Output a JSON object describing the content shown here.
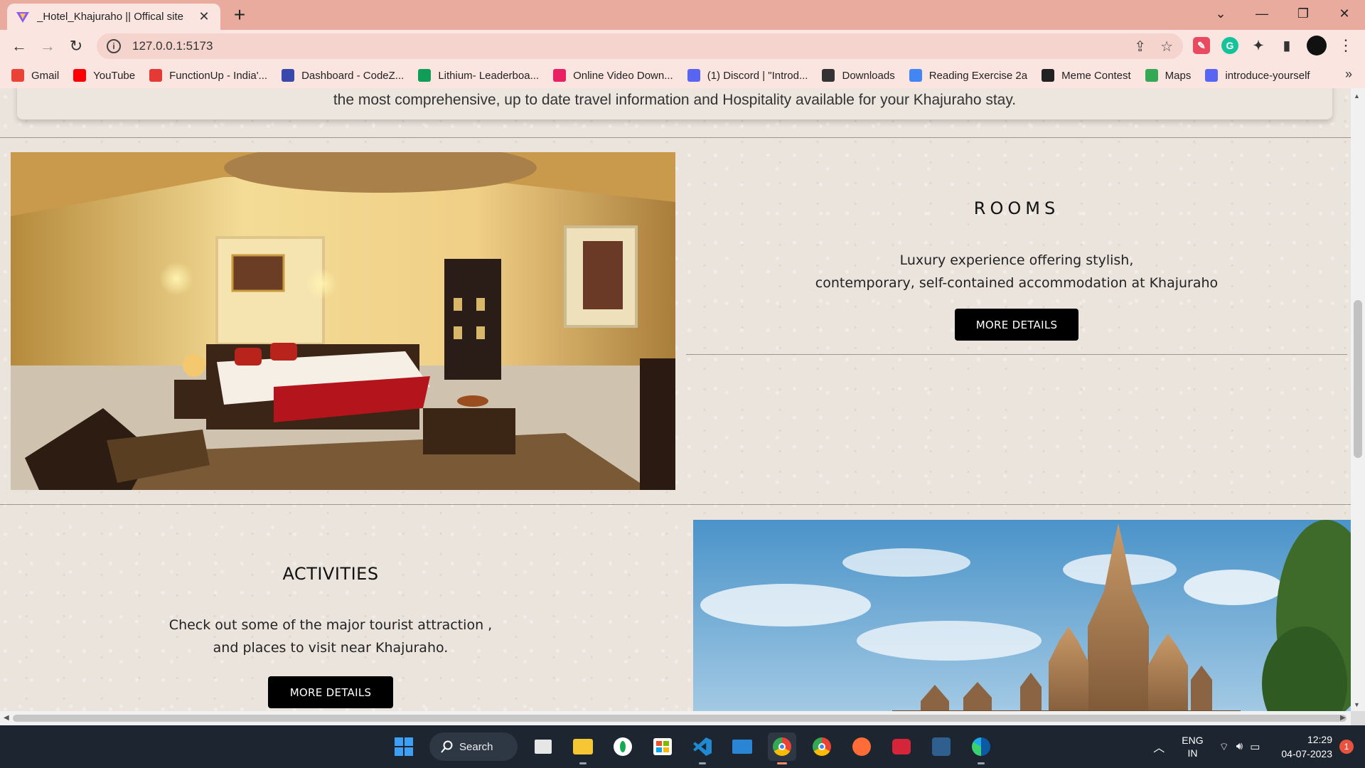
{
  "browser": {
    "tab_title": "_Hotel_Khajuraho || Offical site",
    "url": "127.0.0.1:5173",
    "bookmarks": [
      {
        "label": "Gmail",
        "icon": "gmail-icon",
        "color": "#ea4335"
      },
      {
        "label": "YouTube",
        "icon": "youtube-icon",
        "color": "#ff0000"
      },
      {
        "label": "FunctionUp - India'...",
        "icon": "functionup-icon",
        "color": "#e53935"
      },
      {
        "label": "Dashboard - CodeZ...",
        "icon": "codezinger-icon",
        "color": "#3949ab"
      },
      {
        "label": "Lithium- Leaderboa...",
        "icon": "sheets-icon",
        "color": "#0f9d58"
      },
      {
        "label": "Online Video Down...",
        "icon": "video-download-icon",
        "color": "#e91e63"
      },
      {
        "label": "(1) Discord | \"Introd...",
        "icon": "discord-icon",
        "color": "#5865f2"
      },
      {
        "label": "Downloads",
        "icon": "download-icon",
        "color": "#333333"
      },
      {
        "label": "Reading Exercise 2a",
        "icon": "docs-icon",
        "color": "#4285f4"
      },
      {
        "label": "Meme Contest",
        "icon": "notion-icon",
        "color": "#222222"
      },
      {
        "label": "Maps",
        "icon": "maps-icon",
        "color": "#34a853"
      },
      {
        "label": "introduce-yourself",
        "icon": "discord-icon",
        "color": "#5865f2"
      }
    ],
    "bookmarks_more": "»"
  },
  "page": {
    "intro_text": "the most comprehensive, up to date travel information and Hospitality available for your Khajuraho stay.",
    "rooms": {
      "title": "ROOMS",
      "desc_line1": "Luxury experience offering stylish,",
      "desc_line2": "contemporary, self-contained accommodation at Khajuraho",
      "button": "MORE DETAILS"
    },
    "activities": {
      "title": "ACTIVITIES",
      "desc_line1": "Check out some of the major tourist attraction ,",
      "desc_line2": "and places to visit near Khajuraho.",
      "button": "MORE DETAILS"
    }
  },
  "taskbar": {
    "search_label": "Search",
    "lang_line1": "ENG",
    "lang_line2": "IN",
    "time": "12:29",
    "date": "04-07-2023",
    "notification_count": "1"
  },
  "colors": {
    "chrome_frame": "#e8ab9e",
    "chrome_toolbar": "#fbe5e0",
    "page_bg": "#eae4dc",
    "button_bg": "#000000",
    "taskbar_bg": "#1c2530"
  }
}
